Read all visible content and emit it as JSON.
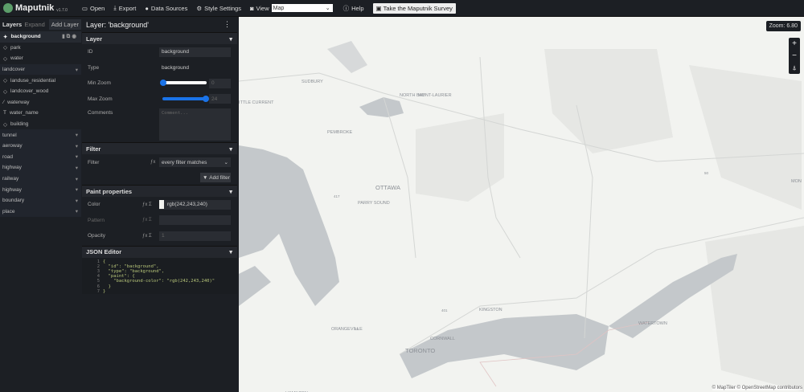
{
  "topbar": {
    "app_name": "Maputnik",
    "version": "v1.7.0",
    "open": "Open",
    "export": "Export",
    "data_sources": "Data Sources",
    "style_settings": "Style Settings",
    "view_label": "View",
    "view_value": "Map",
    "help": "Help",
    "survey": "Take the Maputnik Survey"
  },
  "layers": {
    "title": "Layers",
    "expand": "Expand",
    "add_layer": "Add Layer",
    "items": [
      {
        "label": "background",
        "kind": "layer",
        "icon": "background",
        "selected": true
      },
      {
        "label": "park",
        "kind": "layer",
        "icon": "fill"
      },
      {
        "label": "water",
        "kind": "layer",
        "icon": "fill"
      },
      {
        "label": "landcover",
        "kind": "group"
      },
      {
        "label": "landuse_residential",
        "kind": "layer",
        "icon": "fill"
      },
      {
        "label": "landcover_wood",
        "kind": "layer",
        "icon": "fill"
      },
      {
        "label": "waterway",
        "kind": "layer",
        "icon": "line"
      },
      {
        "label": "water_name",
        "kind": "layer",
        "icon": "symbol"
      },
      {
        "label": "building",
        "kind": "layer",
        "icon": "fill"
      },
      {
        "label": "tunnel",
        "kind": "group"
      },
      {
        "label": "aeroway",
        "kind": "group"
      },
      {
        "label": "road",
        "kind": "group"
      },
      {
        "label": "highway",
        "kind": "group"
      },
      {
        "label": "railway",
        "kind": "group"
      },
      {
        "label": "highway",
        "kind": "group"
      },
      {
        "label": "boundary",
        "kind": "group"
      },
      {
        "label": "place",
        "kind": "group"
      }
    ]
  },
  "editor": {
    "title": "Layer: 'background'",
    "layer_section": "Layer",
    "id_label": "ID",
    "id_value": "background",
    "type_label": "Type",
    "type_value": "background",
    "minzoom_label": "Min Zoom",
    "minzoom_value": "0",
    "maxzoom_label": "Max Zoom",
    "maxzoom_value": "24",
    "comments_label": "Comments",
    "comments_placeholder": "Comment...",
    "filter_section": "Filter",
    "filter_label": "Filter",
    "filter_value": "every filter matches",
    "add_filter": "Add filter",
    "paint_section": "Paint properties",
    "color_label": "Color",
    "color_value": "rgb(242,243,240)",
    "pattern_label": "Pattern",
    "opacity_label": "Opacity",
    "opacity_value": "1",
    "json_section": "JSON Editor",
    "json_lines": [
      "{",
      "  \"id\": \"background\",",
      "  \"type\": \"background\",",
      "  \"paint\": {",
      "    \"background-color\": \"rgb(242,243,240)\"",
      "  }",
      "}"
    ]
  },
  "map": {
    "zoom": "Zoom: 6.80",
    "attribution": "© MapTiler © OpenStreetMap contributors",
    "places": [
      "SUDBURY",
      "NORTH BAY",
      "MONT-LAURIER",
      "PEMBROKE",
      "OTTAWA",
      "PARRY SOUND",
      "ORANGEVILLE",
      "TORONTO",
      "HAMILTON",
      "KINGSTON",
      "WATERTOWN",
      "CORNWALL",
      "MON",
      "LITTLE CURRENT"
    ],
    "roads": [
      "417",
      "401",
      "50",
      "15",
      "81"
    ]
  },
  "colors": {
    "background": "#f2f3f0",
    "water": "#c4c8cb",
    "accent": "#1a73e8"
  }
}
